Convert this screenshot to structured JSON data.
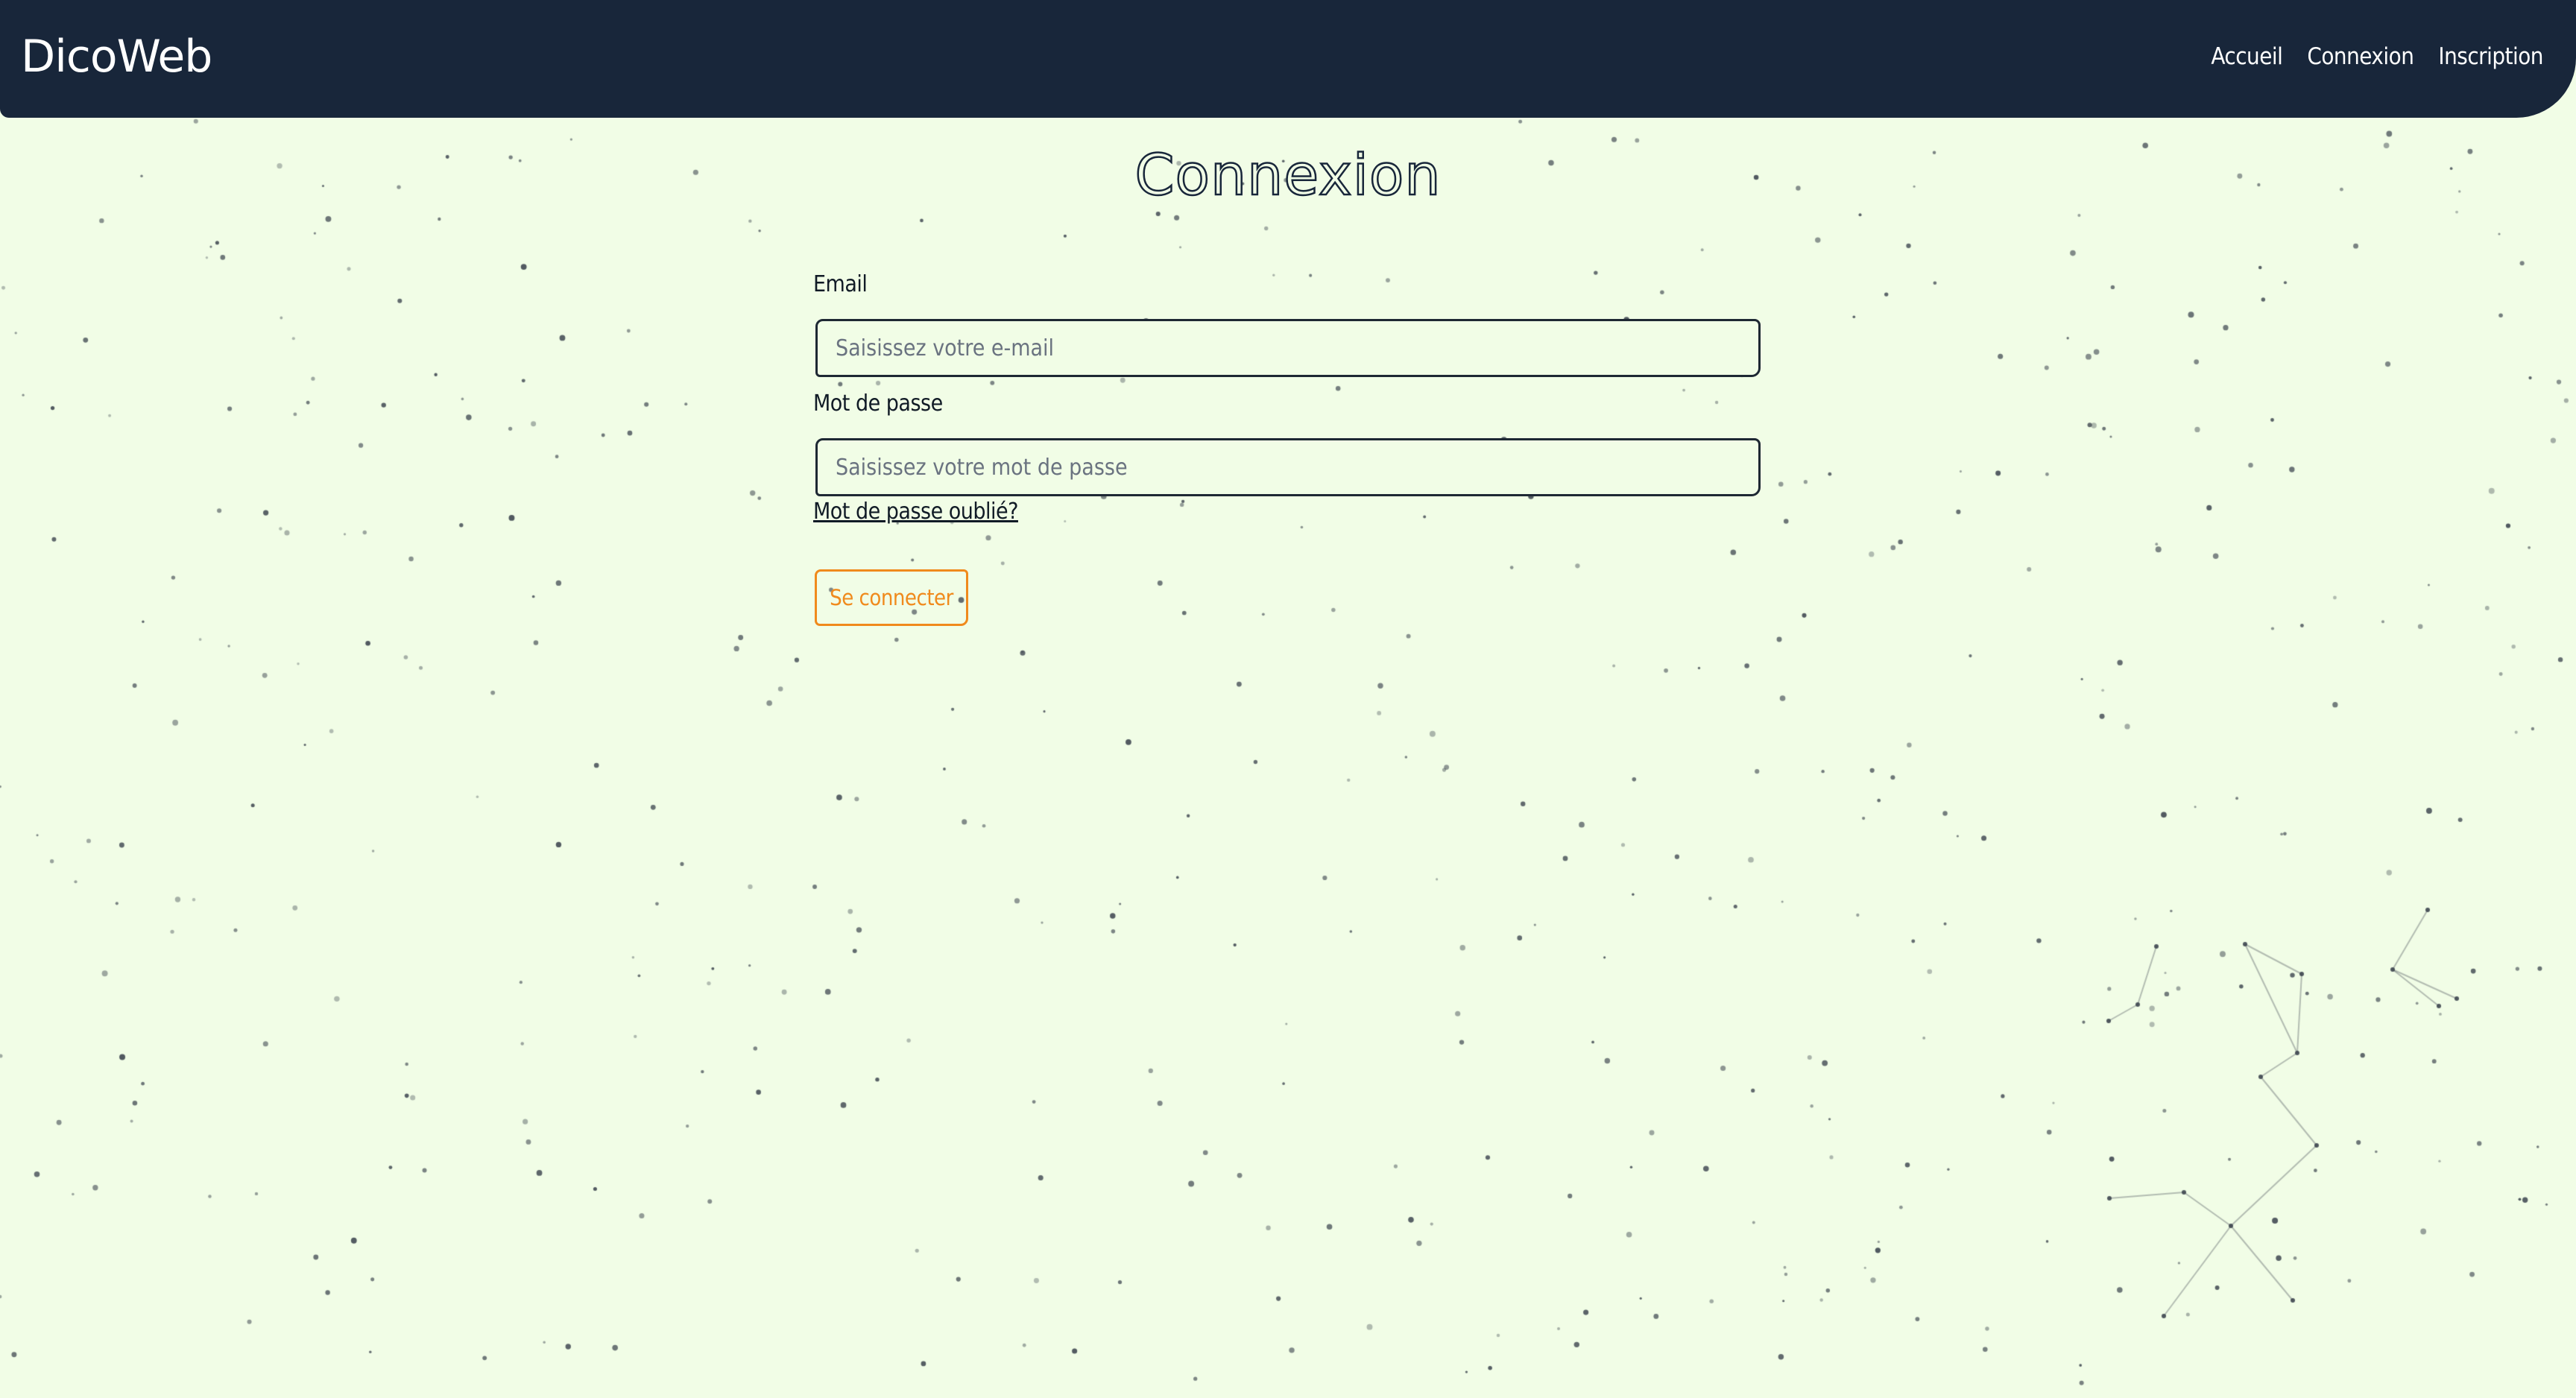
{
  "colors": {
    "page_background": "#f1fde6",
    "navbar_background": "#18263a",
    "navbar_text": "#ffffff",
    "text_dark": "#111b26",
    "accent_orange": "#f08a1c",
    "input_border": "#1e2833",
    "placeholder": "#6a7380",
    "particles": "#3e4650"
  },
  "navbar": {
    "brand": "DicoWeb",
    "links": [
      {
        "label": "Accueil"
      },
      {
        "label": "Connexion"
      },
      {
        "label": "Inscription"
      }
    ]
  },
  "page": {
    "title": "Connexion"
  },
  "form": {
    "email": {
      "label": "Email",
      "value": "",
      "placeholder": "Saisissez votre e-mail"
    },
    "password": {
      "label": "Mot de passe",
      "value": "",
      "placeholder": "Saisissez votre mot de passe"
    },
    "forgot_password_label": "Mot de passe oublié?",
    "submit_label": "Se connecter"
  }
}
